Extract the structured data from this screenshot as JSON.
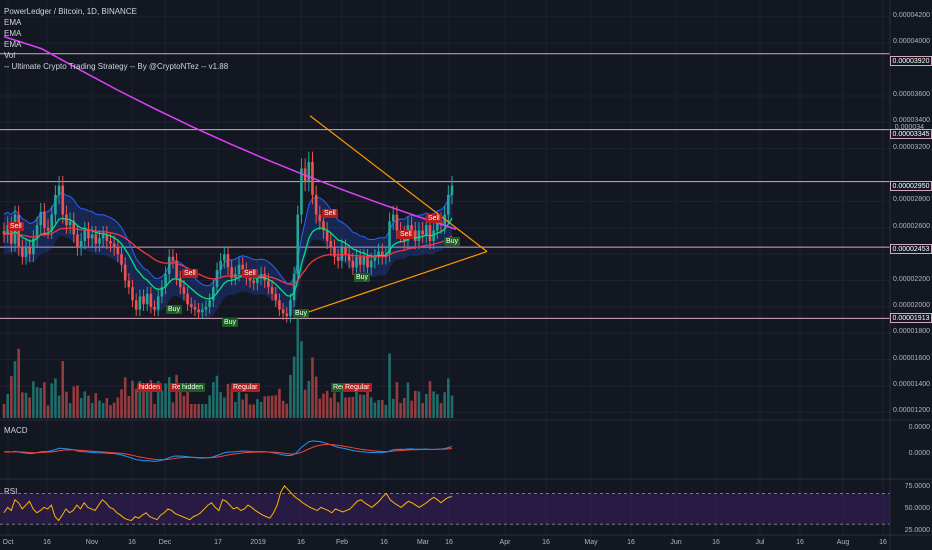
{
  "legend": {
    "symbol_line": "PowerLedger / Bitcoin, 1D, BINANCE",
    "indicators": [
      "EMA",
      "EMA",
      "EMA",
      "Vol",
      "-- Ultimate Crypto Trading Strategy -- By @CryptoNTez -- v1.88"
    ]
  },
  "price_axis": {
    "ticks": [
      "0.00004200",
      "0.00004000",
      "0.00003600",
      "0.00003400",
      "0.00003200",
      "0.00002800",
      "0.00002600",
      "0.00002400",
      "0.00002200",
      "0.00002000",
      "0.00001800",
      "0.00001600",
      "0.00001400",
      "0.00001200"
    ],
    "level_labels": [
      "0.00003920",
      "0.00003345",
      "0.00002950",
      "0.00002453",
      "0.00001913"
    ],
    "partial_label": "0.000034"
  },
  "macd": {
    "title": "MACD",
    "ticks": [
      "0.0000",
      "0.0000"
    ]
  },
  "rsi": {
    "title": "RSI",
    "ticks": [
      "75.0000",
      "50.0000",
      "25.0000"
    ]
  },
  "time_axis": [
    "Oct",
    "16",
    "Nov",
    "16",
    "Dec",
    "17",
    "2019",
    "16",
    "Feb",
    "16",
    "Mar",
    "16",
    "Apr",
    "16",
    "May",
    "16",
    "Jun",
    "16",
    "Jul",
    "16",
    "Aug",
    "16"
  ],
  "signals": [
    {
      "text": "Sell",
      "kind": "sell"
    },
    {
      "text": "Sell",
      "kind": "sell"
    },
    {
      "text": "Sell",
      "kind": "sell"
    },
    {
      "text": "Sell",
      "kind": "sell"
    },
    {
      "text": "Sell",
      "kind": "sell"
    },
    {
      "text": "Sell",
      "kind": "sell"
    },
    {
      "text": "Buy",
      "kind": "buy"
    },
    {
      "text": "Buy",
      "kind": "buy"
    },
    {
      "text": "Buy",
      "kind": "buy"
    },
    {
      "text": "Buy",
      "kind": "buy"
    },
    {
      "text": "Buy",
      "kind": "buy"
    },
    {
      "text": "hidden",
      "kind": "div"
    },
    {
      "text": "Re",
      "kind": "div"
    },
    {
      "text": "hidden",
      "kind": "divg"
    },
    {
      "text": "Regular",
      "kind": "div"
    },
    {
      "text": "Reg",
      "kind": "divg"
    },
    {
      "text": "Regular",
      "kind": "divg"
    }
  ],
  "colors": {
    "background": "#131722",
    "up": "#26a69a",
    "down": "#ef5350",
    "ema_magenta": "#e040fb",
    "ema_red": "#f23645",
    "ema_green": "#00e676",
    "cloud": "#2962ff",
    "triangle": "#ff9800",
    "level": "#d9a8c0",
    "macd_line": "#2196f3",
    "signal_line": "#f44336",
    "rsi_line": "#ffb300",
    "rsi_band": "#3b1f5e"
  },
  "chart_data": {
    "type": "candlestick",
    "y_range": [
      1.15e-05,
      4.32e-05
    ],
    "levels": [
      3.92e-05,
      3.345e-05,
      2.95e-05,
      2.453e-05,
      1.913e-05
    ],
    "closes": [
      2.55e-05,
      2.62e-05,
      2.48e-05,
      2.7e-05,
      2.45e-05,
      2.38e-05,
      2.45e-05,
      2.4e-05,
      2.52e-05,
      2.62e-05,
      2.72e-05,
      2.6e-05,
      2.58e-05,
      2.7e-05,
      2.85e-05,
      2.92e-05,
      2.7e-05,
      2.62e-05,
      2.65e-05,
      2.55e-05,
      2.45e-05,
      2.5e-05,
      2.58e-05,
      2.52e-05,
      2.55e-05,
      2.48e-05,
      2.52e-05,
      2.55e-05,
      2.5e-05,
      2.48e-05,
      2.45e-05,
      2.4e-05,
      2.32e-05,
      2.2e-05,
      2.15e-05,
      2.05e-05,
      1.98e-05,
      2.08e-05,
      2.02e-05,
      2.1e-05,
      2e-05,
      1.98e-05,
      2.08e-05,
      2.15e-05,
      2.25e-05,
      2.38e-05,
      2.35e-05,
      2.22e-05,
      2.15e-05,
      2.1e-05,
      2.02e-05,
      2e-05,
      1.98e-05,
      1.96e-05,
      1.98e-05,
      2e-05,
      2.05e-05,
      2.15e-05,
      2.28e-05,
      2.35e-05,
      2.4e-05,
      2.3e-05,
      2.22e-05,
      2.25e-05,
      2.32e-05,
      2.28e-05,
      2.22e-05,
      2.2e-05,
      2.18e-05,
      2.22e-05,
      2.25e-05,
      2.2e-05,
      2.15e-05,
      2.1e-05,
      2.05e-05,
      1.98e-05,
      1.95e-05,
      1.93e-05,
      2.05e-05,
      2.25e-05,
      2.7e-05,
      3.05e-05,
      2.95e-05,
      3.1e-05,
      2.85e-05,
      2.7e-05,
      2.65e-05,
      2.58e-05,
      2.5e-05,
      2.45e-05,
      2.38e-05,
      2.35e-05,
      2.45e-05,
      2.4e-05,
      2.35e-05,
      2.3e-05,
      2.38e-05,
      2.32e-05,
      2.38e-05,
      2.3e-05,
      2.35e-05,
      2.38e-05,
      2.42e-05,
      2.38e-05,
      2.4e-05,
      2.65e-05,
      2.7e-05,
      2.58e-05,
      2.55e-05,
      2.5e-05,
      2.62e-05,
      2.58e-05,
      2.5e-05,
      2.58e-05,
      2.55e-05,
      2.62e-05,
      2.5e-05,
      2.58e-05,
      2.65e-05,
      2.62e-05,
      2.7e-05,
      2.85e-05,
      2.92e-05
    ],
    "ema_slow": [
      4.05e-05,
      3.958e-05,
      3.8e-05,
      3.647e-05,
      3.503e-05,
      3.366e-05,
      3.237e-05,
      3.114e-05,
      2.998e-05,
      2.887e-05,
      2.783e-05,
      2.684e-05,
      2.589e-05
    ],
    "macd": [],
    "rsi": [
      45,
      52,
      48,
      62,
      58,
      50,
      55,
      60,
      50,
      45,
      48,
      52,
      50,
      55,
      40,
      35,
      42,
      50,
      45,
      48,
      55,
      50,
      58,
      52,
      50,
      48,
      55,
      62,
      58,
      52,
      50,
      45,
      42,
      38,
      36,
      35,
      40,
      38,
      42,
      45,
      40,
      38,
      36,
      42,
      45,
      50,
      48,
      44,
      42,
      40,
      38,
      36,
      40,
      42,
      45,
      50,
      55,
      58,
      52,
      48,
      62,
      60,
      55,
      50,
      52,
      48,
      50,
      55,
      52,
      48,
      45,
      42,
      40,
      38,
      45,
      55,
      72,
      80,
      75,
      70,
      65,
      62,
      58,
      55,
      52,
      50,
      48,
      52,
      50,
      48,
      45,
      50,
      48,
      46,
      48,
      50,
      55,
      60,
      62,
      58,
      55,
      52,
      56,
      60,
      66,
      70,
      62,
      58,
      55,
      52,
      56,
      60,
      58,
      55,
      52,
      55,
      58,
      62,
      65,
      62,
      58,
      62,
      65,
      66
    ],
    "time_labels": [
      "Oct",
      "16",
      "Nov",
      "16",
      "Dec",
      "17",
      "2019",
      "16",
      "Feb",
      "16",
      "Mar",
      "16",
      "Apr",
      "16",
      "May",
      "16",
      "Jun",
      "16",
      "Jul",
      "16",
      "Aug",
      "16"
    ]
  }
}
